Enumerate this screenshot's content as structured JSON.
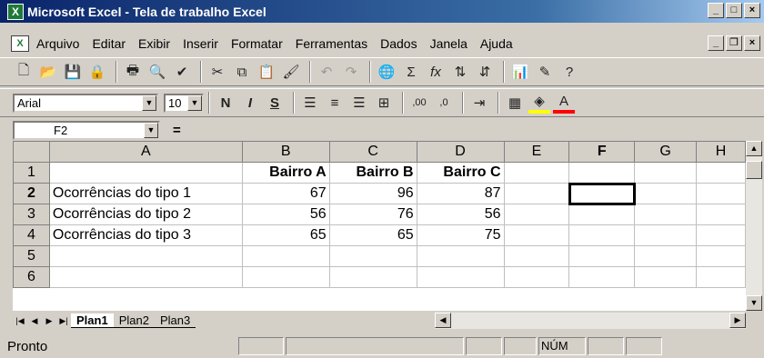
{
  "window": {
    "title": "Microsoft Excel - Tela de trabalho Excel",
    "controls": [
      "minimize",
      "maximize",
      "close"
    ]
  },
  "menu": {
    "items": [
      "Arquivo",
      "Editar",
      "Exibir",
      "Inserir",
      "Formatar",
      "Ferramentas",
      "Dados",
      "Janela",
      "Ajuda"
    ]
  },
  "toolbar_standard": {
    "icons": [
      "new-icon",
      "open-icon",
      "save-icon",
      "permission-icon",
      "print-icon",
      "print-preview-icon",
      "spelling-icon",
      "cut-icon",
      "copy-icon",
      "paste-icon",
      "format-painter-icon",
      "undo-icon",
      "redo-icon",
      "hyperlink-icon",
      "autosum-icon",
      "function-icon",
      "sort-ascending-icon",
      "sort-descending-icon",
      "chart-wizard-icon",
      "drawing-icon",
      "help-icon"
    ]
  },
  "toolbar_format": {
    "font": "Arial",
    "size": "10",
    "bold": "N",
    "italic": "I",
    "underline": "S"
  },
  "formula_bar": {
    "name_box": "F2",
    "equals": "=",
    "content": ""
  },
  "grid": {
    "columns": [
      "A",
      "B",
      "C",
      "D",
      "E",
      "F",
      "G",
      "H"
    ],
    "active_column": "F",
    "active_row": "2",
    "rows": [
      {
        "num": "1",
        "cells": [
          "",
          "Bairro A",
          "Bairro B",
          "Bairro C",
          "",
          "",
          "",
          ""
        ]
      },
      {
        "num": "2",
        "cells": [
          "Ocorrências do tipo 1",
          "67",
          "96",
          "87",
          "",
          "",
          "",
          ""
        ]
      },
      {
        "num": "3",
        "cells": [
          "Ocorrências do tipo 2",
          "56",
          "76",
          "56",
          "",
          "",
          "",
          ""
        ]
      },
      {
        "num": "4",
        "cells": [
          "Ocorrências do tipo 3",
          "65",
          "65",
          "75",
          "",
          "",
          "",
          ""
        ]
      },
      {
        "num": "5",
        "cells": [
          "",
          "",
          "",
          "",
          "",
          "",
          "",
          ""
        ]
      },
      {
        "num": "6",
        "cells": [
          "",
          "",
          "",
          "",
          "",
          "",
          "",
          ""
        ]
      }
    ]
  },
  "sheets": [
    "Plan1",
    "Plan2",
    "Plan3"
  ],
  "active_sheet": "Plan1",
  "status": {
    "text": "Pronto",
    "num": "NÚM"
  }
}
